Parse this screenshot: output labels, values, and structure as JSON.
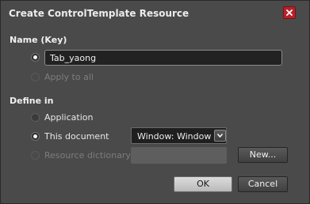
{
  "dialog": {
    "title": "Create ControlTemplate Resource",
    "close_icon": "close-icon",
    "accent_close": "#b8222a"
  },
  "name_key": {
    "section_label": "Name (Key)",
    "input_value": "Tab_yaong",
    "apply_to_all_label": "Apply to all",
    "selected": "name"
  },
  "define_in": {
    "section_label": "Define in",
    "options": [
      {
        "label": "Application",
        "checked": false,
        "disabled": false
      },
      {
        "label": "This document",
        "checked": true,
        "disabled": false
      },
      {
        "label": "Resource dictionary",
        "checked": false,
        "disabled": true
      }
    ],
    "document_select": {
      "value": "Window: Window",
      "arrow_icon": "chevron-down-icon"
    },
    "new_button_label": "New..."
  },
  "footer": {
    "ok_label": "OK",
    "cancel_label": "Cancel"
  }
}
